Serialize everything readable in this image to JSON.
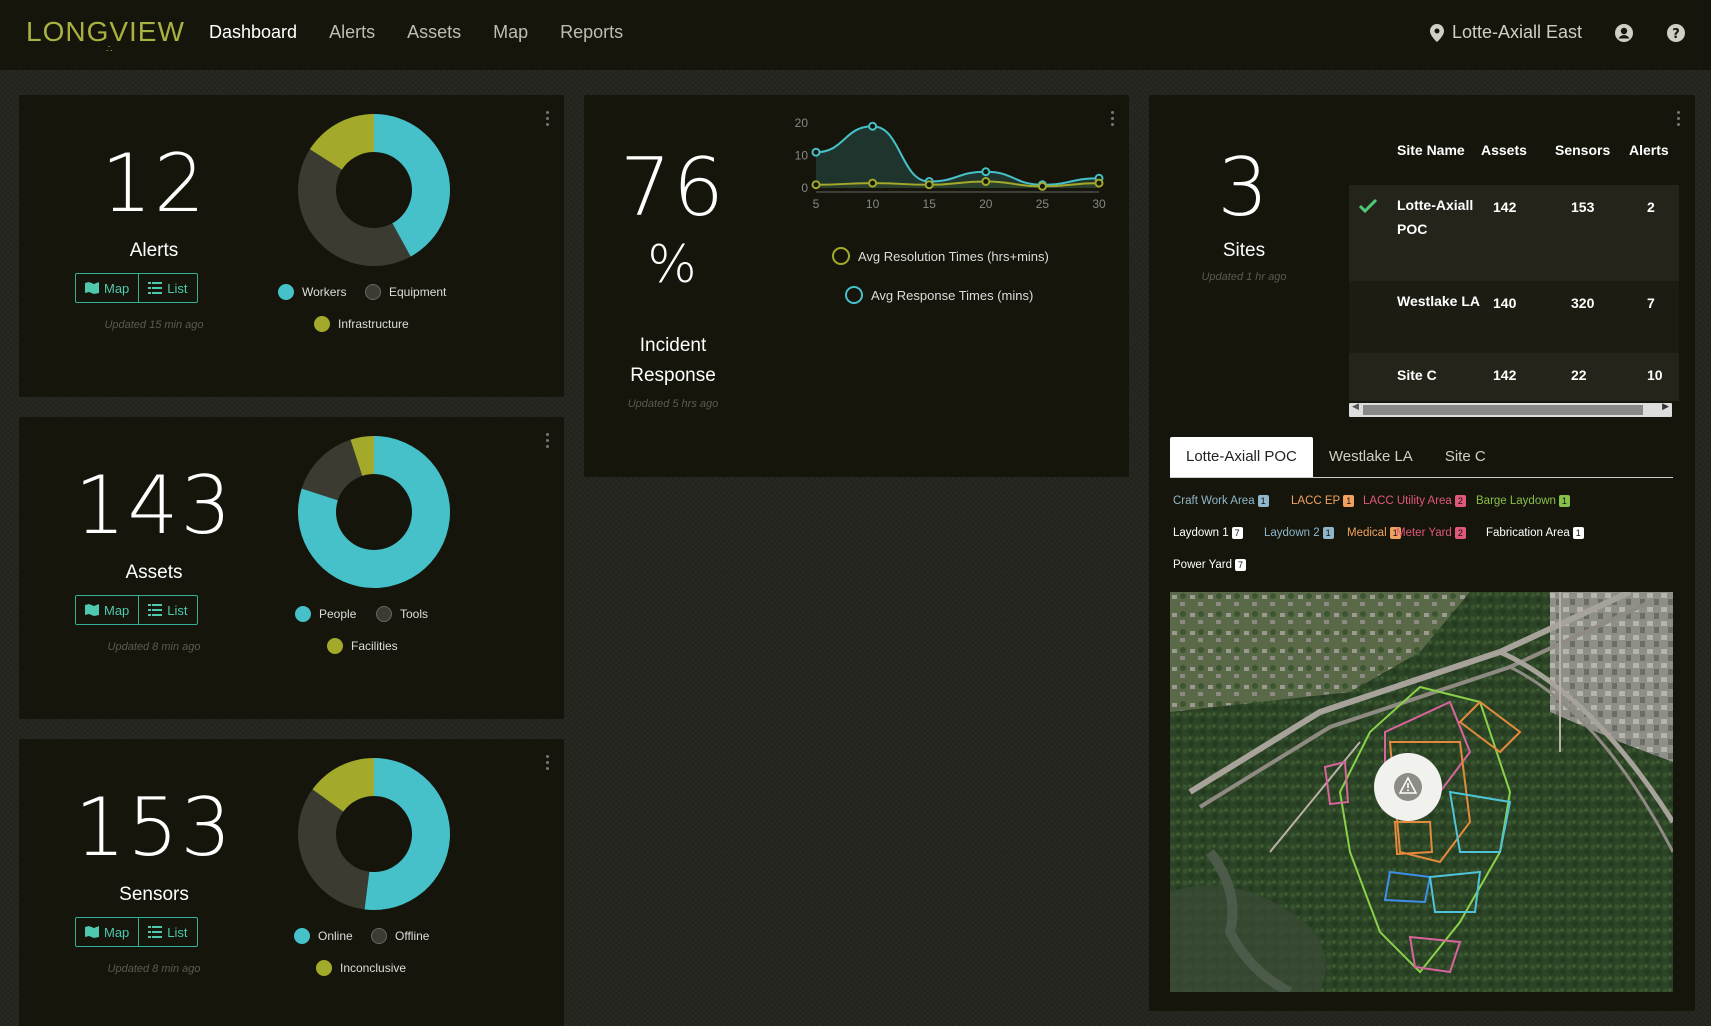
{
  "header": {
    "logo": "LONGVIEW",
    "nav": [
      "Dashboard",
      "Alerts",
      "Assets",
      "Map",
      "Reports"
    ],
    "active_nav": "Dashboard",
    "site": "Lotte-Axiall East"
  },
  "cards": {
    "alerts": {
      "count": "12",
      "label": "Alerts",
      "map": "Map",
      "list": "List",
      "updated": "Updated 15 min ago",
      "legend": [
        "Workers",
        "Equipment",
        "Infrastructure"
      ],
      "donut": [
        {
          "name": "Workers",
          "value": 0.42,
          "color": "#46c1c9"
        },
        {
          "name": "Equipment",
          "value": 0.42,
          "color": "#3c3b32"
        },
        {
          "name": "Infrastructure",
          "value": 0.16,
          "color": "#a3a92b"
        }
      ]
    },
    "assets": {
      "count": "143",
      "label": "Assets",
      "map": "Map",
      "list": "List",
      "updated": "Updated 8 min ago",
      "legend": [
        "People",
        "Tools",
        "Facilities"
      ],
      "donut": [
        {
          "name": "People",
          "value": 0.8,
          "color": "#46c1c9"
        },
        {
          "name": "Tools",
          "value": 0.15,
          "color": "#3c3b32"
        },
        {
          "name": "Facilities",
          "value": 0.05,
          "color": "#a3a92b"
        }
      ]
    },
    "sensors": {
      "count": "153",
      "label": "Sensors",
      "map": "Map",
      "list": "List",
      "updated": "Updated 8 min ago",
      "legend": [
        "Online",
        "Offline",
        "Inconclusive"
      ],
      "donut": [
        {
          "name": "Online",
          "value": 0.52,
          "color": "#46c1c9"
        },
        {
          "name": "Offline",
          "value": 0.33,
          "color": "#3c3b32"
        },
        {
          "name": "Inconclusive",
          "value": 0.15,
          "color": "#a3a92b"
        }
      ]
    },
    "incident": {
      "value": "76",
      "unit": "%",
      "label1": "Incident",
      "label2": "Response",
      "updated": "Updated 5 hrs ago"
    },
    "sites": {
      "count": "3",
      "label": "Sites",
      "updated": "Updated 1 hr ago",
      "columns": [
        "Site Name",
        "Assets",
        "Sensors",
        "Alerts"
      ],
      "rows": [
        {
          "name": "Lotte-Axiall POC",
          "assets": "142",
          "sensors": "153",
          "alerts": "2",
          "selected": true
        },
        {
          "name": "Westlake LA",
          "assets": "140",
          "sensors": "320",
          "alerts": "7",
          "selected": false
        },
        {
          "name": "Site C",
          "assets": "142",
          "sensors": "22",
          "alerts": "10",
          "selected": false
        }
      ],
      "tabs": [
        "Lotte-Axiall POC",
        "Westlake LA",
        "Site C"
      ],
      "zones": [
        {
          "name": "Craft Work Area",
          "count": "1",
          "color": "#8fb7c9"
        },
        {
          "name": "LACC EP",
          "count": "1",
          "color": "#f1a25e"
        },
        {
          "name": "LACC Utility Area",
          "count": "2",
          "color": "#e0587a"
        },
        {
          "name": "Barge Laydown",
          "count": "1",
          "color": "#86c04a"
        },
        {
          "name": "Laydown 1",
          "count": "7",
          "color": "#ffffff"
        },
        {
          "name": "Laydown 2",
          "count": "1",
          "color": "#8fb7c9"
        },
        {
          "name": "Medical",
          "count": "1",
          "color": "#f1a25e"
        },
        {
          "name": "Meter Yard",
          "count": "2",
          "color": "#e0587a"
        },
        {
          "name": "Fabrication Area",
          "count": "1",
          "color": "#ffffff"
        },
        {
          "name": "Power Yard",
          "count": "7",
          "color": "#ffffff"
        }
      ]
    }
  },
  "chart_data": {
    "type": "line",
    "x": [
      5,
      10,
      15,
      20,
      25,
      30
    ],
    "ylim": [
      0,
      20
    ],
    "yticks": [
      0,
      10,
      20
    ],
    "series": [
      {
        "name": "Avg Response Times (mins)",
        "x": [
          5,
          10,
          15,
          20,
          25,
          30
        ],
        "values": [
          11,
          19,
          2,
          5,
          1,
          3
        ],
        "color": "#46c1c9"
      },
      {
        "name": "Avg Resolution Times (hrs+mins)",
        "x": [
          5,
          10,
          15,
          20,
          25,
          30
        ],
        "values": [
          1,
          1.5,
          1,
          2,
          0.5,
          1.5
        ],
        "color": "#a3a92b"
      }
    ]
  }
}
